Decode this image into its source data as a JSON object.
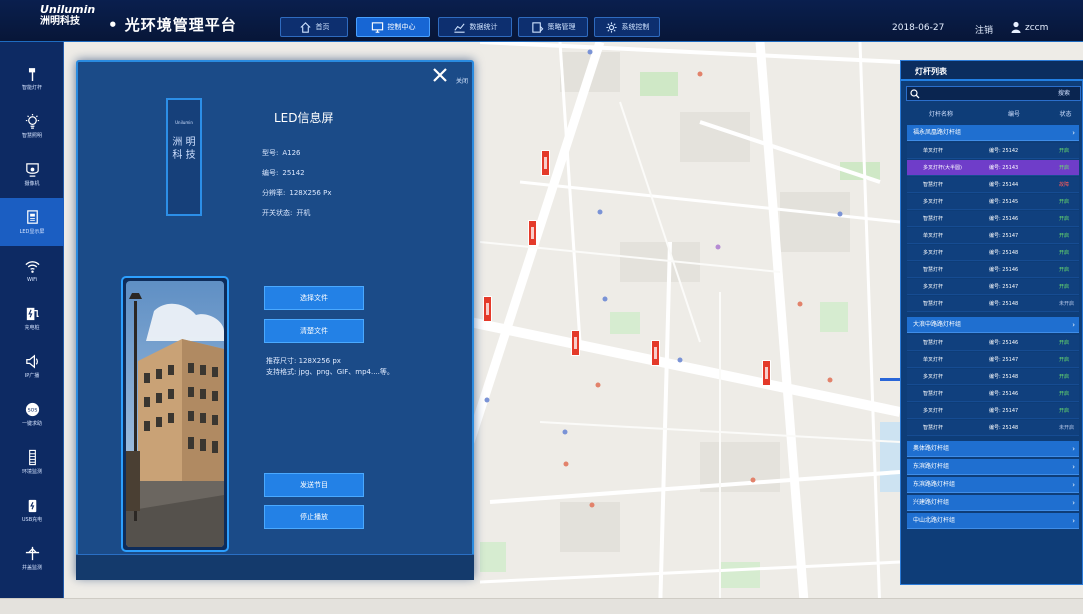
{
  "header": {
    "brand_en": "Unilumin",
    "brand_cn": "洲明科技",
    "title": "• 光环境管理平台",
    "nav": [
      {
        "label": "首页",
        "icon": "home-icon",
        "active": false
      },
      {
        "label": "控制中心",
        "icon": "monitor-icon",
        "active": true
      },
      {
        "label": "数据统计",
        "icon": "chart-icon",
        "active": false
      },
      {
        "label": "策略管理",
        "icon": "strategy-icon",
        "active": false
      },
      {
        "label": "系统控制",
        "icon": "gear-icon",
        "active": false
      }
    ],
    "date": "2018-06-27",
    "logout": "注销",
    "user": "zccm"
  },
  "sidebar": {
    "items": [
      {
        "label": "智能灯杆",
        "icon": "lamp-pole-icon"
      },
      {
        "label": "智慧照明",
        "icon": "bulb-icon"
      },
      {
        "label": "摄像机",
        "icon": "camera-icon"
      },
      {
        "label": "LED显示屏",
        "icon": "led-screen-icon",
        "active": true
      },
      {
        "label": "WiFi",
        "icon": "wifi-icon"
      },
      {
        "label": "充电桩",
        "icon": "charger-icon"
      },
      {
        "label": "IP广播",
        "icon": "speaker-icon"
      },
      {
        "label": "一键求助",
        "icon": "sos-icon"
      },
      {
        "label": "环境监测",
        "icon": "sensor-icon"
      },
      {
        "label": "USB充电",
        "icon": "usb-icon"
      },
      {
        "label": "井盖监测",
        "icon": "antenna-icon"
      }
    ]
  },
  "led_panel": {
    "close_label": "关闭",
    "board_brand": "Unilumin",
    "board_text": "洲 明 科 技",
    "title": "LED信息屏",
    "model_label": "型号:",
    "model": "A126",
    "number_label": "编号:",
    "number": "25142",
    "resolution_label": "分辨率:",
    "resolution": "128X256 Px",
    "status_label": "开关状态:",
    "status": "开机",
    "select_file": "选择文件",
    "clear_file": "清楚文件",
    "recommend_size": "推荐尺寸: 128X256 px",
    "supported_formats": "支持格式: jpg、png、GIF、mp4....等。",
    "send_program": "发送节目",
    "stop_play": "停止播放"
  },
  "lamp_list": {
    "title": "灯杆列表",
    "search_placeholder": "",
    "search_button": "搜索",
    "columns": [
      "灯杆名称",
      "编号",
      "状态"
    ],
    "groups": [
      {
        "name": "福永凤凰路灯杆组",
        "rows": [
          {
            "name": "单叉灯杆",
            "number": "编号: 25142",
            "status": "开启",
            "state": "on"
          },
          {
            "name": "多叉灯杆(大半圆)",
            "number": "编号: 25143",
            "status": "开启",
            "state": "on",
            "selected": true
          },
          {
            "name": "智慧灯杆",
            "number": "编号: 25144",
            "status": "故障",
            "state": "off"
          },
          {
            "name": "多叉灯杆",
            "number": "编号: 25145",
            "status": "开启",
            "state": "on"
          },
          {
            "name": "智慧灯杆",
            "number": "编号: 25146",
            "status": "开启",
            "state": "on"
          },
          {
            "name": "单叉灯杆",
            "number": "编号: 25147",
            "status": "开启",
            "state": "on"
          },
          {
            "name": "多叉灯杆",
            "number": "编号: 25148",
            "status": "开启",
            "state": "on"
          },
          {
            "name": "智慧灯杆",
            "number": "编号: 25146",
            "status": "开启",
            "state": "on"
          },
          {
            "name": "多叉灯杆",
            "number": "编号: 25147",
            "status": "开启",
            "state": "on"
          },
          {
            "name": "智慧灯杆",
            "number": "编号: 25148",
            "status": "未开启",
            "state": "mid"
          }
        ]
      },
      {
        "name": "大浪中路路灯杆组",
        "rows": [
          {
            "name": "智慧灯杆",
            "number": "编号: 25146",
            "status": "开启",
            "state": "on"
          },
          {
            "name": "单叉灯杆",
            "number": "编号: 25147",
            "status": "开启",
            "state": "on"
          },
          {
            "name": "多叉灯杆",
            "number": "编号: 25148",
            "status": "开启",
            "state": "on"
          },
          {
            "name": "智慧灯杆",
            "number": "编号: 25146",
            "status": "开启",
            "state": "on"
          },
          {
            "name": "多叉灯杆",
            "number": "编号: 25147",
            "status": "开启",
            "state": "on"
          },
          {
            "name": "智慧灯杆",
            "number": "编号: 25148",
            "status": "未开启",
            "state": "mid"
          }
        ]
      },
      {
        "name": "奥体路灯杆组",
        "rows": []
      },
      {
        "name": "东滨路灯杆组",
        "rows": []
      },
      {
        "name": "东滨路路灯杆组",
        "rows": []
      },
      {
        "name": "兴建路灯杆组",
        "rows": []
      },
      {
        "name": "中山北路灯杆组",
        "rows": []
      }
    ]
  },
  "colors": {
    "header_bg": "#0a1f4e",
    "panel_bg": "#1b4b88",
    "accent": "#2381e6",
    "selected_row": "#6f3dc9",
    "status_on": "#6be06b",
    "status_fault": "#ff5a5a",
    "map_pin": "#e43a2a"
  }
}
